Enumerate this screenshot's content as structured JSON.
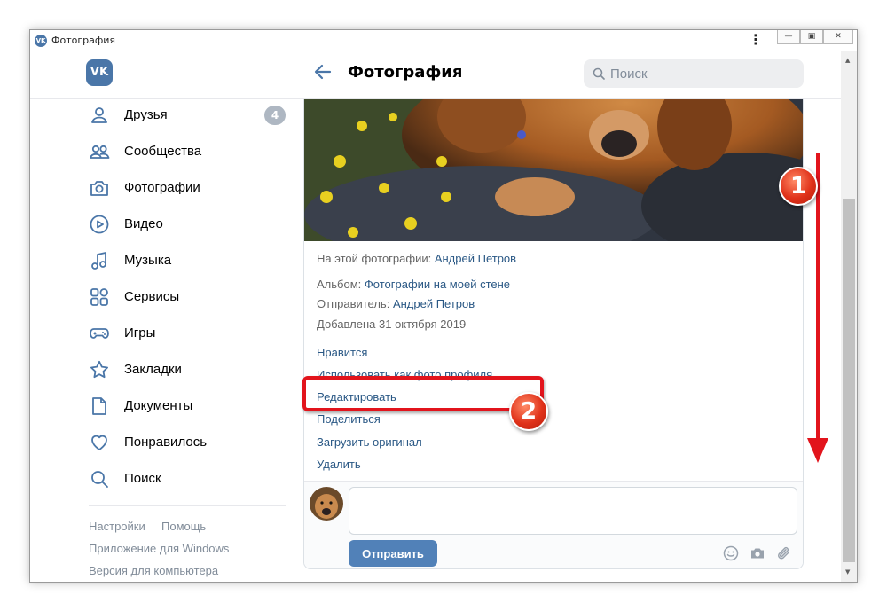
{
  "window": {
    "title": "Фотография",
    "app_icon": "VK"
  },
  "header": {
    "logo": "VK",
    "page_title": "Фотография",
    "search_placeholder": "Поиск"
  },
  "sidebar": {
    "items": [
      {
        "label": "Друзья",
        "icon": "user-icon",
        "badge": "4"
      },
      {
        "label": "Сообщества",
        "icon": "users-icon"
      },
      {
        "label": "Фотографии",
        "icon": "camera-icon"
      },
      {
        "label": "Видео",
        "icon": "play-icon"
      },
      {
        "label": "Музыка",
        "icon": "music-icon"
      },
      {
        "label": "Сервисы",
        "icon": "services-icon"
      },
      {
        "label": "Игры",
        "icon": "gamepad-icon"
      },
      {
        "label": "Закладки",
        "icon": "star-icon"
      },
      {
        "label": "Документы",
        "icon": "document-icon"
      },
      {
        "label": "Понравилось",
        "icon": "heart-icon"
      },
      {
        "label": "Поиск",
        "icon": "search-icon"
      }
    ],
    "footer": {
      "settings": "Настройки",
      "help": "Помощь",
      "windows_app": "Приложение для Windows",
      "desktop_version": "Версия для компьютера"
    }
  },
  "photo_info": {
    "on_photo_label": "На этой фотографии:",
    "on_photo_person": "Андрей Петров",
    "album_label": "Альбом:",
    "album_name": "Фотографии на моей стене",
    "sender_label": "Отправитель:",
    "sender_name": "Андрей Петров",
    "added": "Добавлена 31 октября 2019"
  },
  "actions": {
    "like": "Нравится",
    "set_profile": "Использовать как фото профиля",
    "edit": "Редактировать",
    "share": "Поделиться",
    "download": "Загрузить оригинал",
    "delete": "Удалить"
  },
  "comment": {
    "value": "",
    "send_label": "Отправить"
  },
  "annotations": {
    "marker_1": "1",
    "marker_2": "2"
  },
  "colors": {
    "vk_blue": "#4a76a8",
    "link": "#2a5885",
    "button": "#5181b8",
    "annotation_red": "#e2141c"
  }
}
